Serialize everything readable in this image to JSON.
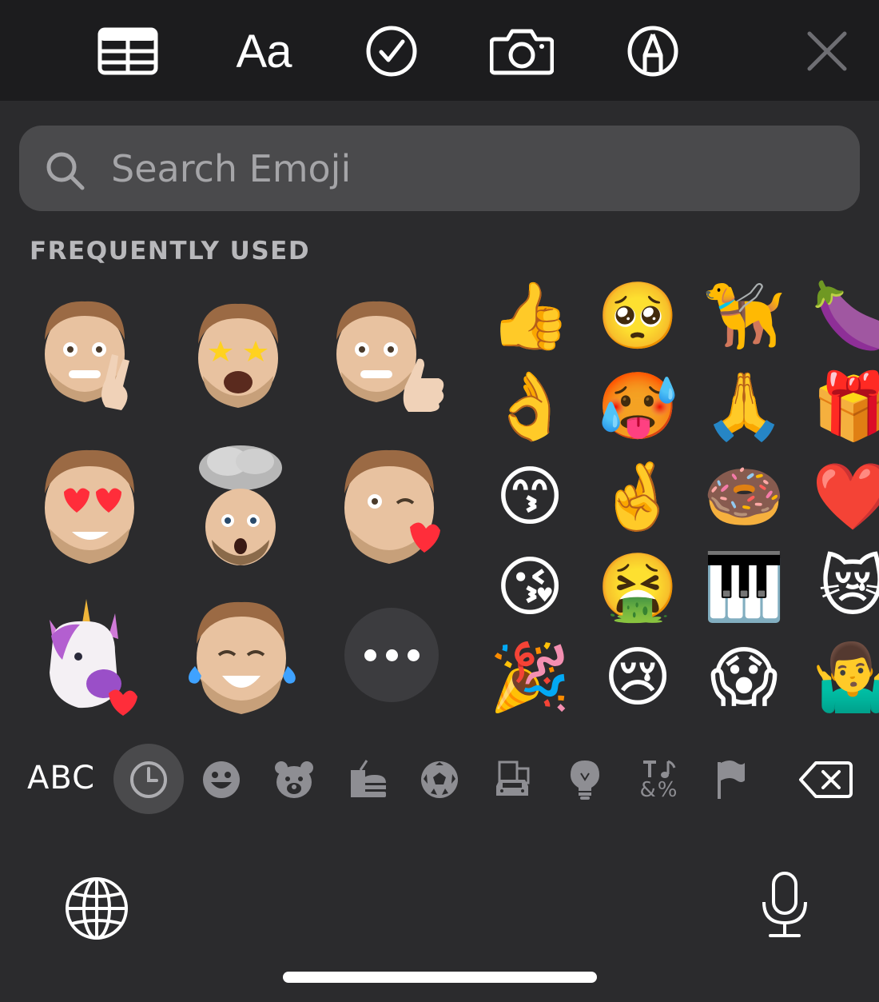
{
  "toolbar": {
    "items": [
      {
        "name": "table-icon"
      },
      {
        "name": "format-text-icon",
        "label": "Aa"
      },
      {
        "name": "checklist-icon"
      },
      {
        "name": "camera-icon"
      },
      {
        "name": "markup-pen-icon"
      },
      {
        "name": "close-icon"
      }
    ],
    "format_label": "Aa"
  },
  "search": {
    "placeholder": "Search Emoji"
  },
  "section": {
    "label": "FREQUENTLY USED"
  },
  "memoji": [
    {
      "name": "memoji-peace-sign"
    },
    {
      "name": "memoji-star-eyes"
    },
    {
      "name": "memoji-thumbs-up"
    },
    {
      "name": "memoji-heart-eyes"
    },
    {
      "name": "memoji-mind-blown"
    },
    {
      "name": "memoji-wink-kiss"
    },
    {
      "name": "memoji-unicorn-heart"
    },
    {
      "name": "memoji-tears-of-joy"
    }
  ],
  "emoji_grid": [
    [
      "👍",
      "🥺",
      "🦮",
      "🍆"
    ],
    [
      "👌",
      "🥵",
      "🙏",
      "🎁"
    ],
    [
      "😙",
      "🤞",
      "🍩",
      "❤️"
    ],
    [
      "😘",
      "🤮",
      "🎹",
      "😿"
    ],
    [
      "🎉",
      "😢",
      "😱",
      "🤷‍♂️"
    ]
  ],
  "keyboard": {
    "abc_label": "ABC",
    "categories": [
      {
        "name": "recent-clock-icon",
        "active": true
      },
      {
        "name": "smileys-icon"
      },
      {
        "name": "animals-bear-icon"
      },
      {
        "name": "food-icon"
      },
      {
        "name": "activity-ball-icon"
      },
      {
        "name": "travel-buildings-icon"
      },
      {
        "name": "objects-lightbulb-icon"
      },
      {
        "name": "symbols-icon",
        "label": "&%"
      },
      {
        "name": "flags-icon"
      }
    ],
    "symbols_label": "&%"
  },
  "colors": {
    "background": "#2b2b2d",
    "toolbar": "#1c1c1e",
    "search_field": "#4a4a4c",
    "section_label": "#b8b8bb",
    "icon_gray": "#8e8e93"
  }
}
